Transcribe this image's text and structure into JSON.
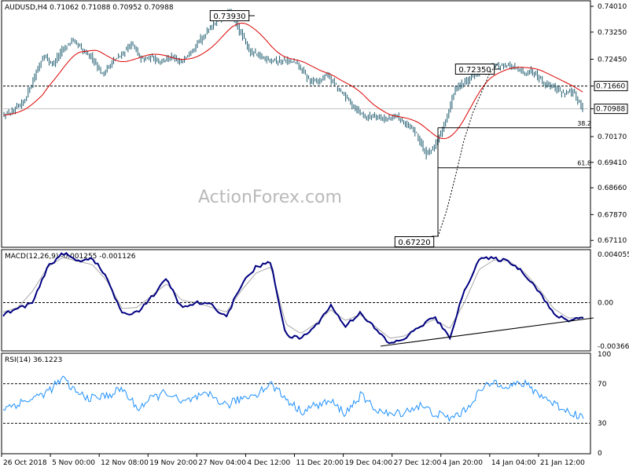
{
  "chart_data": {
    "type": "candlestick",
    "symbol_header": "AUDUSD,H4  0.71062 0.71088 0.70952 0.70988",
    "watermark": "ActionForex.com",
    "price_panel": {
      "ylim": [
        0.6693,
        0.7415
      ],
      "y_ticks": [
        "0.74010",
        "0.73250",
        "0.72450",
        "0.71660",
        "0.70988",
        "0.70170",
        "0.69410",
        "0.68660",
        "0.67870",
        "0.67110"
      ],
      "current_price_label": "0.70988",
      "resistance_level": 0.7166,
      "resistance_label": "0.71660",
      "annotations": [
        {
          "label": "0.73930",
          "x": "4 Dec 2018",
          "value": 0.7393
        },
        {
          "label": "0.72350",
          "x": "4 Jan 2019",
          "value": 0.7235
        },
        {
          "label": "0.67220",
          "x": "3 Jan 2019",
          "value": 0.6722
        }
      ],
      "fibonacci": [
        {
          "label": "38.2",
          "value": 0.7043
        },
        {
          "label": "61.8",
          "value": 0.6925
        }
      ],
      "moving_average_color": "#dd0000",
      "candle_color": "#1c5a6e",
      "swing_path": [
        0.6722,
        0.6798,
        0.6898,
        0.7005,
        0.7085,
        0.7145,
        0.7205,
        0.7235
      ]
    },
    "macd_panel": {
      "title": "MACD(12,26,9) -0.001255 -0.001126",
      "ylim": [
        -0.004,
        0.0044
      ],
      "y_ticks": [
        "0.004055",
        "0.00",
        "-0.003662"
      ],
      "main_color": "#000080",
      "signal_color": "#a8a8a8"
    },
    "rsi_panel": {
      "title": "RSI(14) 36.1223",
      "ylim": [
        0,
        100
      ],
      "y_ticks": [
        "100",
        "70",
        "30",
        "0"
      ],
      "line_color": "#1e90ff"
    },
    "x_axis_labels": [
      "26 Oct 2018",
      "5 Nov 00:00",
      "12 Nov 08:00",
      "19 Nov 20:00",
      "27 Nov 04:00",
      "4 Dec 12:00",
      "11 Dec 20:00",
      "19 Dec 04:00",
      "27 Dec 12:00",
      "4 Jan 20:00",
      "14 Jan 04:00",
      "21 Jan 12:00"
    ],
    "price_anchors": [
      0.708,
      0.709,
      0.712,
      0.7185,
      0.7255,
      0.723,
      0.7275,
      0.7302,
      0.727,
      0.725,
      0.72,
      0.7235,
      0.726,
      0.729,
      0.7245,
      0.725,
      0.724,
      0.725,
      0.7235,
      0.727,
      0.73,
      0.734,
      0.7365,
      0.7385,
      0.733,
      0.727,
      0.7255,
      0.7245,
      0.724,
      0.724,
      0.723,
      0.7185,
      0.718,
      0.72,
      0.716,
      0.713,
      0.7095,
      0.7075,
      0.708,
      0.7065,
      0.708,
      0.705,
      0.703,
      0.6965,
      0.699,
      0.706,
      0.716,
      0.718,
      0.72,
      0.7215,
      0.7225,
      0.723,
      0.722,
      0.7205,
      0.721,
      0.7175,
      0.7165,
      0.7145,
      0.715,
      0.7099
    ],
    "macd_anchors": [
      -0.001,
      -0.0005,
      0.0,
      0.003,
      0.0042,
      0.0035,
      0.0038,
      0.002,
      -0.001,
      -0.0008,
      0.0005,
      0.002,
      -0.0005,
      0.0,
      -0.0002,
      -0.0012,
      0.0015,
      0.003,
      0.0034,
      -0.0028,
      -0.003,
      -0.002,
      -0.0002,
      -0.002,
      -0.0008,
      -0.0022,
      -0.0035,
      -0.003,
      -0.002,
      -0.0012,
      -0.003,
      0.001,
      0.0037,
      0.0037,
      0.0035,
      0.0025,
      0.001,
      -0.001,
      -0.0015,
      -0.0012
    ],
    "signal_anchors": [
      -0.0008,
      -0.0004,
      0.001,
      0.003,
      0.0038,
      0.0035,
      0.0032,
      0.0018,
      -0.0005,
      -0.0004,
      0.0006,
      0.0016,
      0.0002,
      0.0,
      -0.0004,
      -0.0008,
      0.001,
      0.0025,
      0.003,
      -0.0018,
      -0.0026,
      -0.0018,
      -0.0006,
      -0.0015,
      -0.001,
      -0.002,
      -0.003,
      -0.0028,
      -0.002,
      -0.0014,
      -0.0022,
      0.0,
      0.0028,
      0.0036,
      0.0035,
      0.0026,
      0.0012,
      -0.0005,
      -0.0013,
      -0.0012
    ],
    "rsi_anchors": [
      45,
      50,
      55,
      62,
      75,
      60,
      55,
      58,
      65,
      45,
      55,
      62,
      50,
      56,
      58,
      48,
      55,
      60,
      70,
      55,
      42,
      48,
      52,
      40,
      58,
      45,
      38,
      42,
      48,
      40,
      35,
      42,
      62,
      72,
      68,
      70,
      60,
      50,
      42,
      36
    ]
  }
}
